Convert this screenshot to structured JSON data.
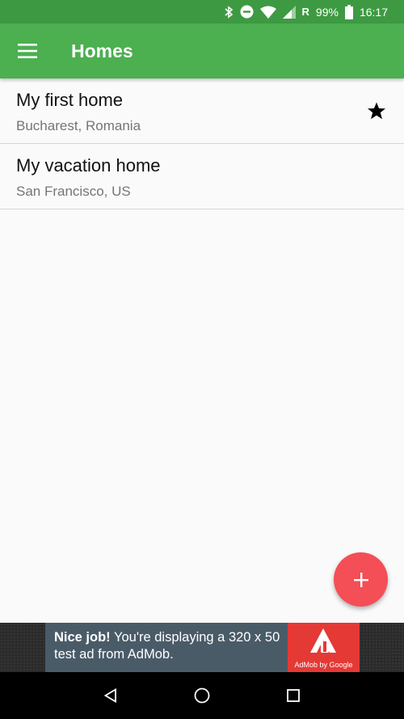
{
  "status_bar": {
    "network_label": "R",
    "battery": "99%",
    "time": "16:17"
  },
  "app_bar": {
    "title": "Homes",
    "menu_icon": "hamburger-menu-icon"
  },
  "homes": [
    {
      "name": "My first home",
      "location": "Bucharest, Romania",
      "favorite": true
    },
    {
      "name": "My vacation home",
      "location": "San Francisco, US",
      "favorite": false
    }
  ],
  "fab": {
    "icon": "add-icon"
  },
  "ad": {
    "bold_text": "Nice job!",
    "text": " You're displaying a 320 x 50 test ad from AdMob.",
    "logo_caption": "AdMob by Google"
  },
  "colors": {
    "status_bar": "#3e9a42",
    "app_bar": "#4caf50",
    "fab": "#f44e56"
  }
}
